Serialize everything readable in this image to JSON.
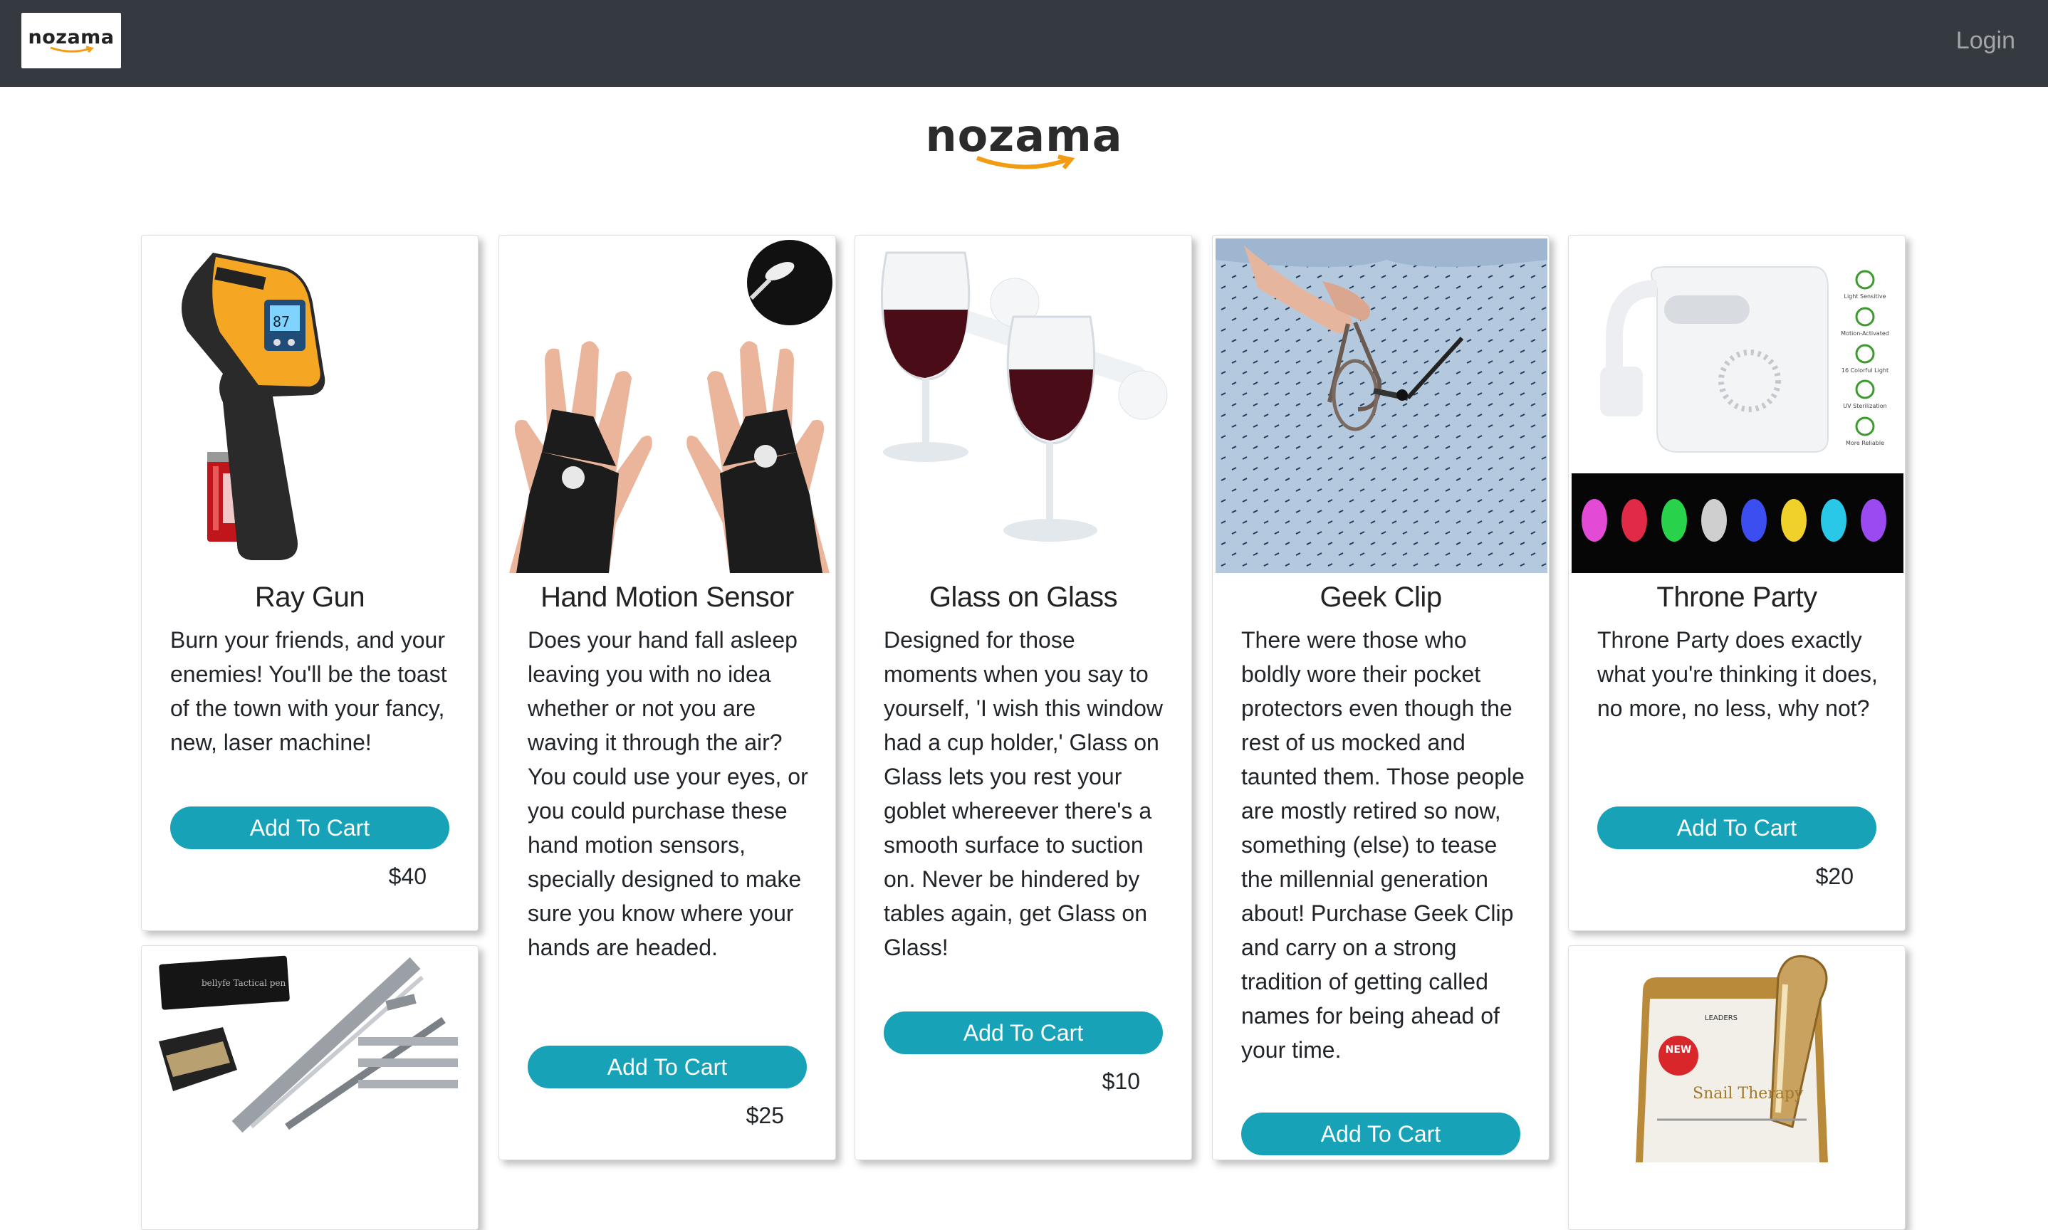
{
  "navbar": {
    "logo_text": "nozama",
    "login_label": "Login"
  },
  "hero": {
    "logo_text": "nozama"
  },
  "colors": {
    "navbar_bg": "#343a40",
    "button_bg": "#17a2b8",
    "logo_smile": "#f39c12"
  },
  "products": [
    {
      "name": "Ray Gun",
      "description": "Burn your friends, and your enemies! You'll be the toast of the town with your fancy, new, laser machine!",
      "button_label": "Add To Cart",
      "price": "$40",
      "image_icon": "laser-thermometer-image"
    },
    {
      "name": "Hand Motion Sensor",
      "description": "Does your hand fall asleep leaving you with no idea whether or not you are waving it through the air? You could use your eyes, or you could purchase these hand motion sensors, specially designed to make sure you know where your hands are headed.",
      "button_label": "Add To Cart",
      "price": "$25",
      "image_icon": "led-gloves-image"
    },
    {
      "name": "Glass on Glass",
      "description": "Designed for those moments when you say to yourself, 'I wish this window had a cup holder,' Glass on Glass lets you rest your goblet whereever there's a smooth surface to suction on. Never be hindered by tables again, get Glass on Glass!",
      "button_label": "Add To Cart",
      "price": "$10",
      "image_icon": "wine-glass-holder-image"
    },
    {
      "name": "Geek Clip",
      "description": "There were those who boldly wore their pocket protectors even though the rest of us mocked and taunted them. Those people are mostly retired so now, something (else) to tease the millennial generation about! Purchase Geek Clip and carry on a strong tradition of getting called names for being ahead of your time.",
      "button_label": "Add To Cart",
      "price": "",
      "image_icon": "glasses-clip-image"
    },
    {
      "name": "Throne Party",
      "description": "Throne Party does exactly what you're thinking it does, no more, no less, why not?",
      "button_label": "Add To Cart",
      "price": "$20",
      "image_icon": "toilet-light-image",
      "feature_labels": [
        "Light Sensitive",
        "Motion-Activated",
        "16 Colorful Light",
        "UV Sterilization",
        "More Reliable"
      ]
    },
    {
      "name": "",
      "image_icon": "tactical-pen-image",
      "box_text": "bellyfe Tactical pen"
    },
    {
      "name": "",
      "image_icon": "snail-mask-image",
      "box_text": "Snail Therapy",
      "brand_text": "LEADERS",
      "badge_text": "NEW"
    }
  ]
}
